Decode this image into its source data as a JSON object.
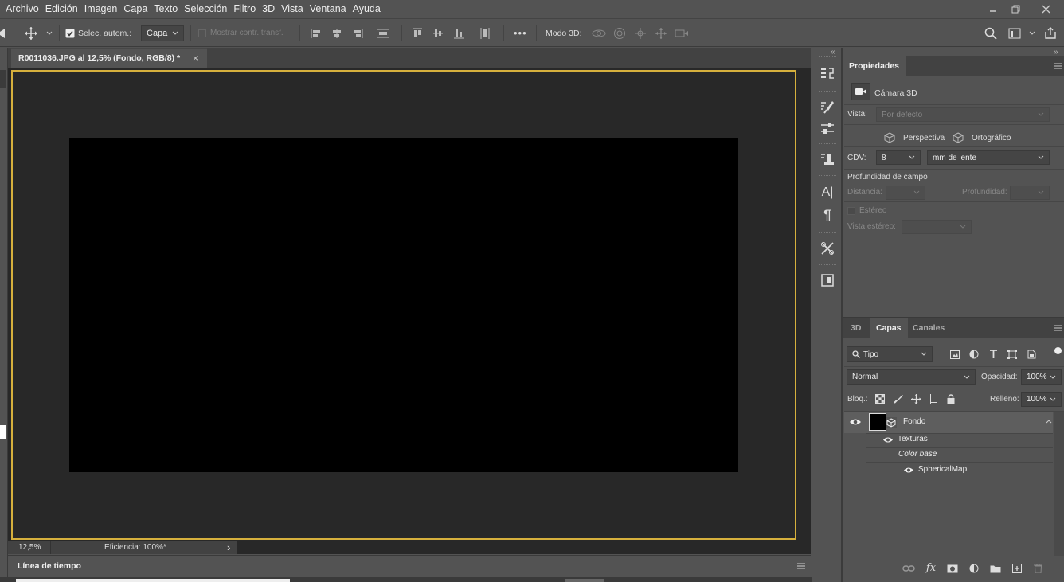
{
  "menu": [
    "Archivo",
    "Edición",
    "Imagen",
    "Capa",
    "Texto",
    "Selección",
    "Filtro",
    "3D",
    "Vista",
    "Ventana",
    "Ayuda"
  ],
  "options": {
    "auto_select_label": "Selec. autom.:",
    "auto_select_target": "Capa",
    "show_transform_label": "Mostrar contr. transf.",
    "mode3d_label": "Modo 3D:",
    "more": "•••"
  },
  "document": {
    "tab_title": "R0011036.JPG al 12,5% (Fondo, RGB/8) *",
    "close": "×",
    "zoom": "12,5%",
    "status": "Eficiencia: 100%*",
    "status_arrow": "›",
    "frame_color": "#d6b03d",
    "canvas_color": "#000000"
  },
  "timeline": {
    "label": "Línea de tiempo"
  },
  "dock": {
    "char_icon": "A|",
    "para_icon": "¶"
  },
  "properties": {
    "tab": "Propiedades",
    "object": "Cámara 3D",
    "view_label": "Vista:",
    "view_value": "Por defecto",
    "perspective": "Perspectiva",
    "orthographic": "Ortográfico",
    "fov_label": "CDV:",
    "fov_value": "8",
    "fov_unit": "mm de lente",
    "dof_label": "Profundidad de campo",
    "distance_label": "Distancia:",
    "depth_label": "Profundidad:",
    "stereo_label": "Estéreo",
    "stereo_view_label": "Vista estéreo:"
  },
  "layers": {
    "tabs": [
      "3D",
      "Capas",
      "Canales"
    ],
    "active_tab": "Capas",
    "filter": "Tipo",
    "blend_mode": "Normal",
    "opacity_label": "Opacidad:",
    "opacity_value": "100%",
    "lock_label": "Bloq.:",
    "fill_label": "Relleno:",
    "fill_value": "100%",
    "layer_name": "Fondo",
    "textures": "Texturas",
    "base_color": "Color base",
    "map": "SphericalMap",
    "fx": "fx"
  }
}
